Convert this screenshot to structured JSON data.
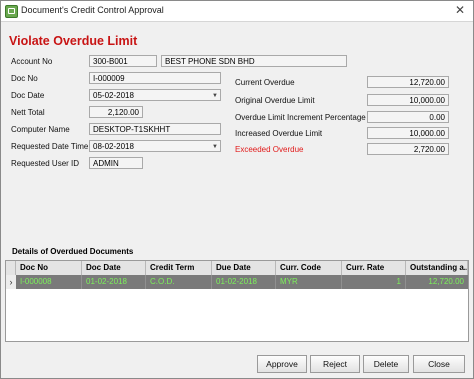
{
  "window": {
    "title": "Document's Credit Control Approval",
    "close_glyph": "✕"
  },
  "heading": "Violate Overdue Limit",
  "left_fields": {
    "account_no_label": "Account No",
    "account_no": "300-B001",
    "account_name": "BEST PHONE SDN BHD",
    "doc_no_label": "Doc No",
    "doc_no": "I-000009",
    "doc_date_label": "Doc Date",
    "doc_date": "05-02-2018",
    "nett_total_label": "Nett Total",
    "nett_total": "2,120.00",
    "computer_name_label": "Computer Name",
    "computer_name": "DESKTOP-T1SKHHT",
    "requested_datetime_label": "Requested Date Time",
    "requested_datetime": "08-02-2018",
    "requested_user_label": "Requested User ID",
    "requested_user": "ADMIN"
  },
  "right_fields": {
    "current_overdue_label": "Current Overdue",
    "current_overdue": "12,720.00",
    "original_limit_label": "Original Overdue Limit",
    "original_limit": "10,000.00",
    "increment_pct_label": "Overdue Limit Increment Percentage",
    "increment_pct": "0.00",
    "increased_limit_label": "Increased Overdue Limit",
    "increased_limit": "10,000.00",
    "exceeded_label": "Exceeded Overdue",
    "exceeded": "2,720.00"
  },
  "details": {
    "title": "Details of Overdued Documents",
    "columns": [
      "Doc No",
      "Doc Date",
      "Credit Term",
      "Due Date",
      "Curr. Code",
      "Curr. Rate",
      "Outstanding a..."
    ],
    "rows": [
      [
        "I-000008",
        "01-02-2018",
        "C.O.D.",
        "01-02-2018",
        "MYR",
        "1",
        "12,720.00"
      ]
    ],
    "row_indicator": "›"
  },
  "buttons": {
    "approve": "Approve",
    "reject": "Reject",
    "delete": "Delete",
    "close": "Close"
  },
  "icons": {
    "dropdown": "▼"
  },
  "colors": {
    "heading": "#c81414",
    "exceeded_label": "#e11a1a",
    "grid_row_bg": "#7a7a7a",
    "grid_row_text": "#7cf05a"
  }
}
